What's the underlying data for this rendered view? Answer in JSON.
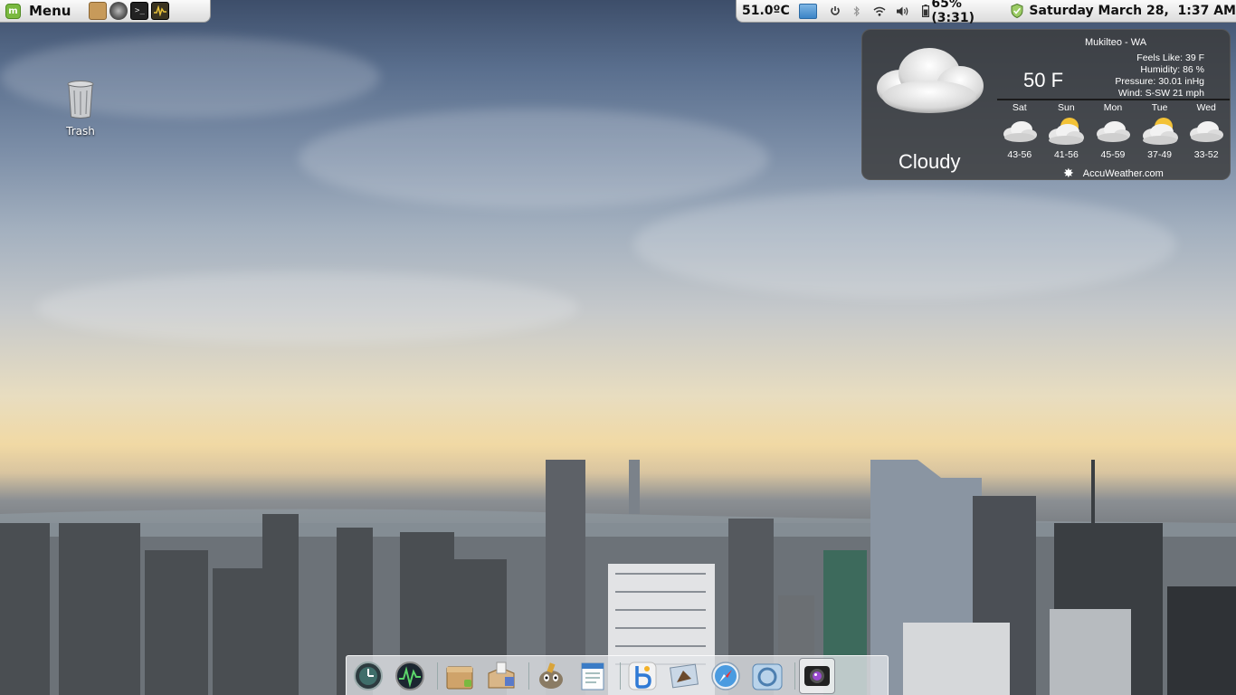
{
  "panel": {
    "menu_label": "Menu",
    "launchers": [
      "file-manager-icon",
      "web-browser-icon",
      "terminal-icon",
      "system-monitor-icon"
    ],
    "cpu_temp": "51.0ºC",
    "battery": "65% (3:31)",
    "clock": "Saturday March 28,  1:37 AM",
    "tray_icons": [
      "folder-icon",
      "power-icon",
      "bluetooth-icon",
      "wifi-icon",
      "volume-icon",
      "battery-icon",
      "shield-icon"
    ]
  },
  "desktop": {
    "trash_label": "Trash"
  },
  "weather": {
    "location": "Mukilteo - WA",
    "temperature": "50 F",
    "condition": "Cloudy",
    "feels_like": "Feels Like: 39 F",
    "humidity": "Humidity: 86 %",
    "pressure": "Pressure: 30.01 inHg",
    "wind": "Wind: S-SW 21 mph",
    "forecast": [
      {
        "day": "Sat",
        "range": "43-56",
        "icon": "cloud-icon"
      },
      {
        "day": "Sun",
        "range": "41-56",
        "icon": "partly-sunny-icon"
      },
      {
        "day": "Mon",
        "range": "45-59",
        "icon": "cloud-icon"
      },
      {
        "day": "Tue",
        "range": "37-49",
        "icon": "partly-sunny-icon"
      },
      {
        "day": "Wed",
        "range": "33-52",
        "icon": "cloud-icon"
      }
    ],
    "source": "AccuWeather.com"
  },
  "dock": {
    "items": [
      "time-machine-icon",
      "activity-monitor-icon",
      "archive-manager-icon",
      "package-installer-icon",
      "gimp-icon",
      "text-editor-icon",
      "bluefish-icon",
      "mail-icon",
      "safari-icon",
      "chromium-icon",
      "camera-icon"
    ],
    "active": "camera-icon"
  },
  "colors": {
    "panel_bg": "#e6e6e6",
    "widget_bg": "#3a3a3a",
    "mint_green": "#7ab940"
  }
}
